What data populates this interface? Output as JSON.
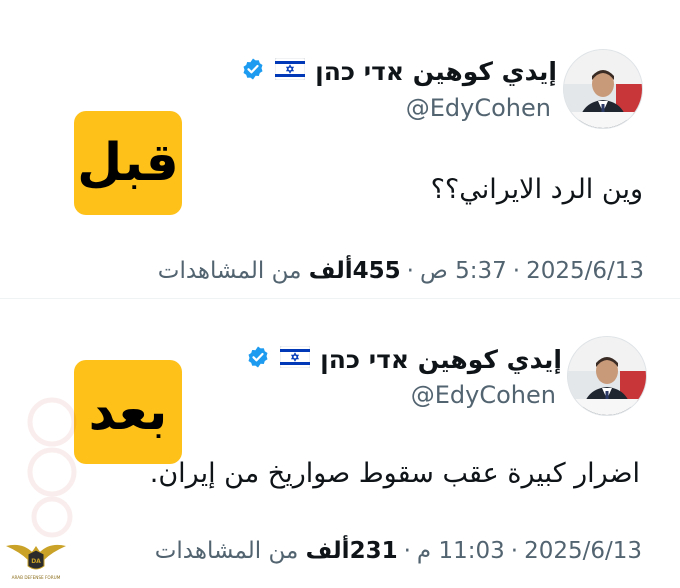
{
  "tweets": [
    {
      "display_name": "إيدي كوهين אדי כהן",
      "handle": "@EdyCohen",
      "flag_icon": "israel-flag-icon",
      "verified_icon": "verified-badge-icon",
      "label": "قبل",
      "text": "وين الرد الايراني؟؟",
      "date": "2025/6/13",
      "time": "5:37 ص",
      "views_count": "455ألف",
      "views_label": "من المشاهدات"
    },
    {
      "display_name": "إيدي كوهين אדי כהן",
      "handle": "@EdyCohen",
      "flag_icon": "israel-flag-icon",
      "verified_icon": "verified-badge-icon",
      "label": "بعد",
      "text": "اضرار كبيرة عقب سقوط صواريخ من إيران.",
      "date": "2025/6/13",
      "time": "11:03 م",
      "views_count": "231ألف",
      "views_label": "من المشاهدات"
    }
  ],
  "colors": {
    "label_bg": "#fec11a",
    "verified_blue": "#1d9bf0",
    "secondary_text": "#536471",
    "flag_blue": "#0038b8"
  },
  "watermark": {
    "icon": "arab-defense-forum-logo",
    "text": "ARAB DEFENSE FORUM"
  }
}
